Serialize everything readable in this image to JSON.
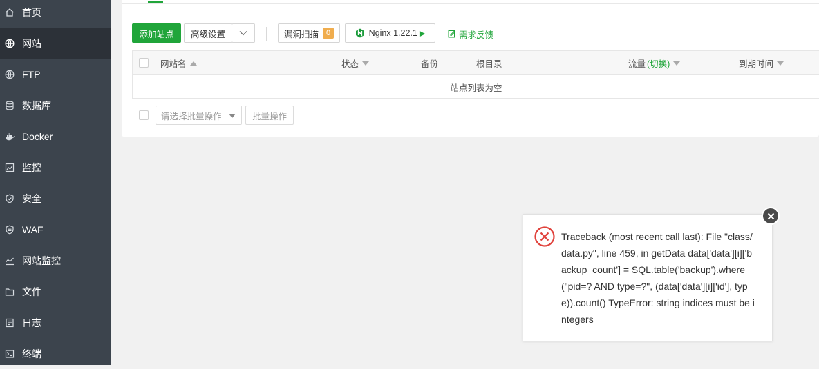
{
  "sidebar": {
    "items": [
      {
        "label": "首页",
        "icon": "home-icon"
      },
      {
        "label": "网站",
        "icon": "globe-icon",
        "active": true
      },
      {
        "label": "FTP",
        "icon": "ftp-globe-icon"
      },
      {
        "label": "数据库",
        "icon": "database-icon"
      },
      {
        "label": "Docker",
        "icon": "docker-icon"
      },
      {
        "label": "监控",
        "icon": "monitor-icon"
      },
      {
        "label": "安全",
        "icon": "shield-icon"
      },
      {
        "label": "WAF",
        "icon": "waf-shield-icon"
      },
      {
        "label": "网站监控",
        "icon": "site-monitor-icon"
      },
      {
        "label": "文件",
        "icon": "folder-icon"
      },
      {
        "label": "日志",
        "icon": "log-icon"
      },
      {
        "label": "终端",
        "icon": "terminal-icon"
      }
    ]
  },
  "toolbar": {
    "add_site": "添加站点",
    "advanced": "高级设置",
    "vuln_scan": "漏洞扫描",
    "vuln_count": "0",
    "nginx": "Nginx 1.22.1",
    "feedback": "需求反馈"
  },
  "table": {
    "columns": {
      "name": "网站名",
      "status": "状态",
      "backup": "备份",
      "root": "根目录",
      "traffic": "流量",
      "traffic_switch": "(切换)",
      "expire": "到期时间"
    },
    "empty_text": "站点列表为空"
  },
  "batch": {
    "placeholder": "请选择批量操作",
    "button": "批量操作"
  },
  "error_dialog": {
    "message": "Traceback (most recent call last): File \"class/data.py\", line 459, in getData data['data'][i]['backup_count'] = SQL.table('backup').where(\"pid=? AND type=?\", (data['data'][i]['id'], type)).count() TypeError: string indices must be integers"
  },
  "colors": {
    "sidebar_bg": "#3c444d",
    "sidebar_active_bg": "#2c3138",
    "accent_green": "#20a53a",
    "badge_orange": "#f0ad4e",
    "error_red": "#e0413b"
  }
}
